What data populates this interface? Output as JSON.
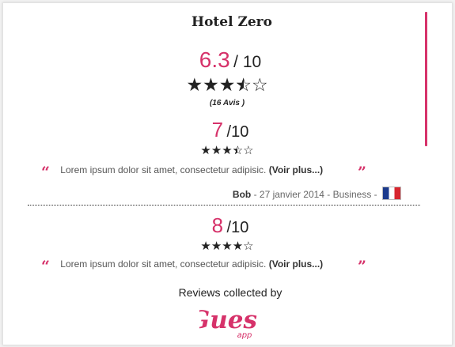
{
  "widget": {
    "hotel_name": "Hotel Zero",
    "overall": {
      "score": "6.3",
      "scale": "/ 10",
      "stars": 3.5,
      "count_label": "(16 Avis )"
    },
    "reviews": [
      {
        "score": "7",
        "scale": "/10",
        "stars": 3.5,
        "text": "Lorem ipsum dolor sit amet, consectetur adipisic.",
        "more_label": "(Voir plus...)",
        "author": "Bob",
        "details": "- 27 janvier 2014 - Business -",
        "flag": "france-flag"
      },
      {
        "score": "8",
        "scale": "/10",
        "stars": 4,
        "text": "Lorem ipsum dolor sit amet, consectetur adipisic.",
        "more_label": "(Voir plus...)"
      }
    ],
    "footer": {
      "collected_label": "Reviews collected by",
      "logo_text": "Guest",
      "logo_subtext": "app"
    },
    "colors": {
      "accent": "#d6326a",
      "star": "#222222"
    }
  }
}
